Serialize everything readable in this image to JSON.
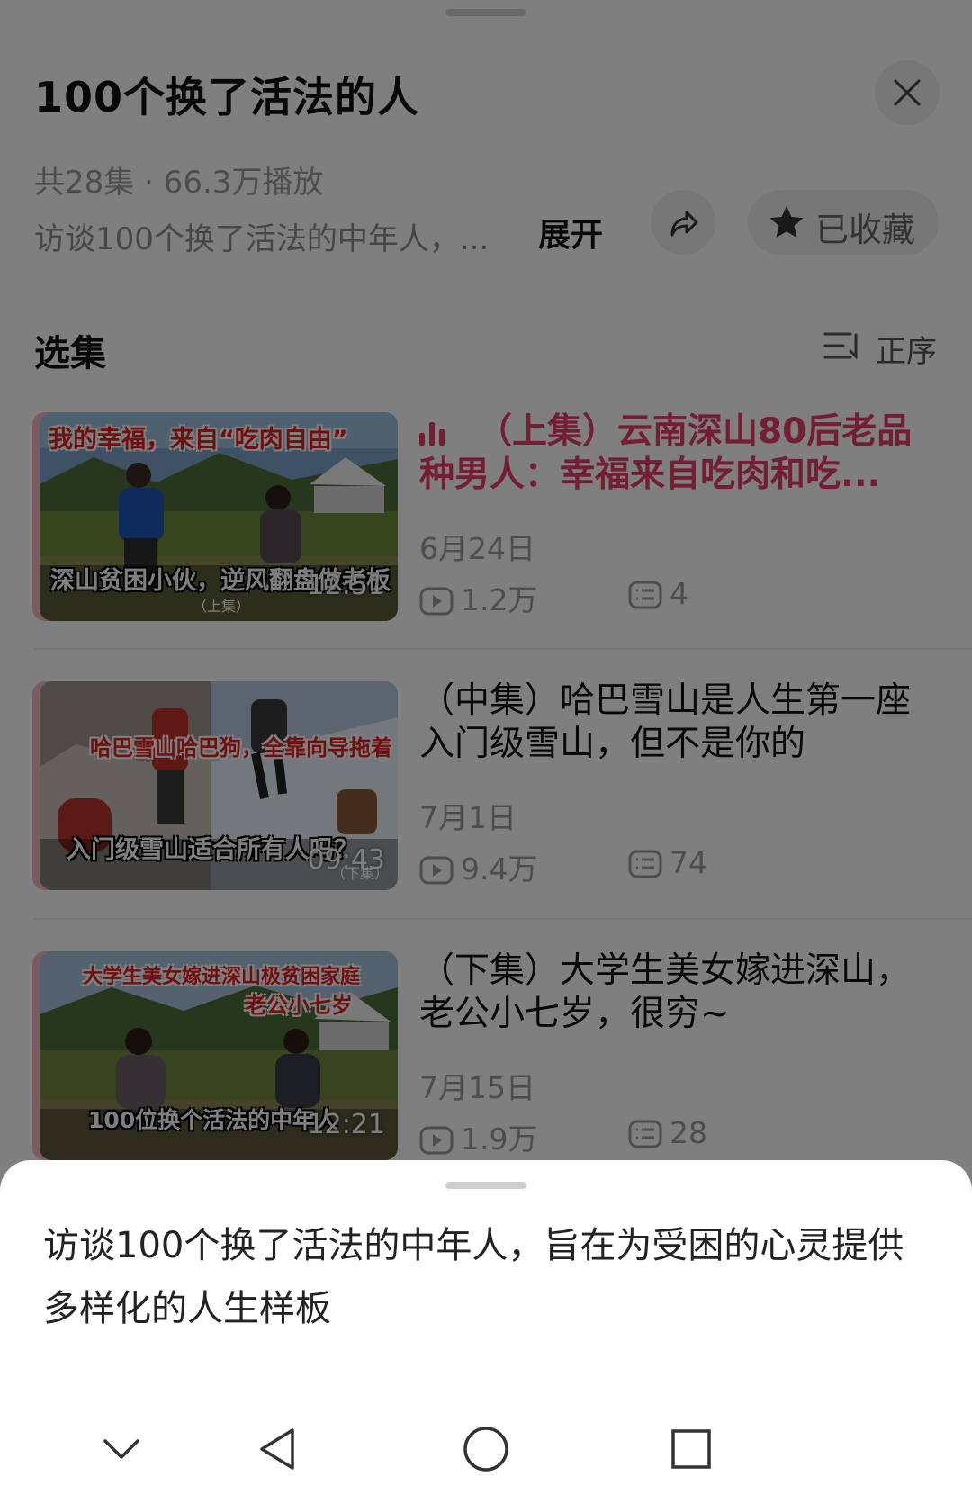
{
  "header": {
    "title": "100个换了活法的人",
    "meta": "共28集 · 66.3万播放",
    "description_preview": "访谈100个换了活法的中年人，...",
    "expand_label": "展开",
    "favorite_label": "已收藏"
  },
  "section": {
    "title": "选集",
    "sort_label": "正序"
  },
  "episodes": [
    {
      "title": "（上集）云南深山80后老品种男人：幸福来自吃肉和吃...",
      "date": "6月24日",
      "plays": "1.2万",
      "comments": "4",
      "duration": "12:51",
      "thumb_caption_top": "我的幸福，来自“吃肉自由”",
      "thumb_caption_bottom": "深山贫困小伙，逆风翻盘做老板",
      "thumb_caption_sub": "（上集）",
      "playing": true
    },
    {
      "title": "（中集）哈巴雪山是人生第一座入门级雪山，但不是你的",
      "date": "7月1日",
      "plays": "9.4万",
      "comments": "74",
      "duration": "09:43",
      "thumb_caption_top": "哈巴雪山哈巴狗，全靠向导拖着",
      "thumb_caption_bottom": "入门级雪山适合所有人吗？",
      "thumb_caption_sub": "（下集）",
      "playing": false
    },
    {
      "title": "（下集）大学生美女嫁进深山，老公小七岁，很穷~",
      "date": "7月15日",
      "plays": "1.9万",
      "comments": "28",
      "duration": "12:21",
      "thumb_caption_top": "大学生美女嫁进深山极贫困家庭",
      "thumb_caption_top2": "老公小七岁",
      "thumb_caption_bottom": "100位换个活法的中年人",
      "playing": false
    }
  ],
  "sheet": {
    "full_description": "访谈100个换了活法的中年人，旨在为受困的心灵提供多样化的人生样板"
  },
  "colors": {
    "accent": "#e83a6b",
    "overlay": "rgba(0,0,0,0.5)"
  },
  "icons": [
    "close-icon",
    "share-icon",
    "star-icon",
    "sort-icon",
    "playing-bars-icon",
    "play-count-icon",
    "comment-icon",
    "nav-collapse-icon",
    "nav-back-icon",
    "nav-home-icon",
    "nav-recents-icon"
  ]
}
